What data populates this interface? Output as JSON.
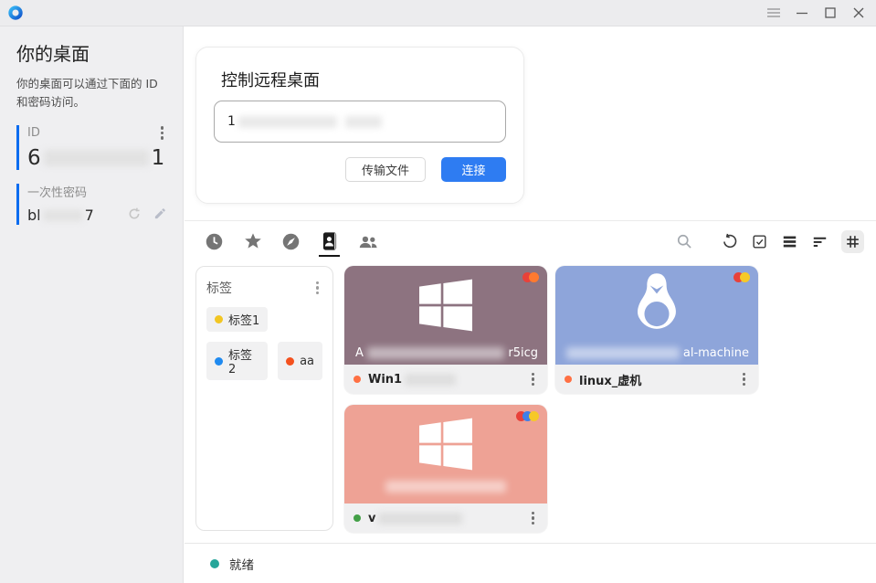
{
  "titlebar": {
    "icons": [
      "menu",
      "minimize",
      "maximize",
      "close"
    ]
  },
  "sidebar": {
    "title": "你的桌面",
    "description": "你的桌面可以通过下面的 ID 和密码访问。",
    "id_label": "ID",
    "id_value_prefix": "6",
    "id_value_suffix": "1",
    "password_label": "一次性密码",
    "password_prefix": "bl",
    "password_suffix": "7",
    "accent_bar_color": "#0a6cf0"
  },
  "connect": {
    "title": "控制远程桌面",
    "id_input_prefix": "1",
    "transfer_file_button": "传输文件",
    "connect_button": "连接",
    "accent_color": "#2e7cf2"
  },
  "toolbar": {
    "tabs": [
      "recent-sessions",
      "favorites",
      "discovered",
      "address-book",
      "groups"
    ],
    "selected_tab": "address-book",
    "actions": [
      "search",
      "refresh",
      "select",
      "list-view",
      "sort-by",
      "grid-view"
    ],
    "active_view": "grid-view"
  },
  "address_book": {
    "tags_title": "标签",
    "tags": [
      {
        "label": "标签1",
        "color": "#f2c623"
      },
      {
        "label": "标签2",
        "color": "#1f8af0"
      },
      {
        "label": "aa",
        "color": "#f4511e"
      }
    ],
    "peers": [
      {
        "name_prefix": "Win1",
        "os": "windows",
        "bg": "#8d7380",
        "status_color": "#ff7043",
        "overlay_prefix": "A",
        "overlay_suffix": "r5icg",
        "dots": [
          "#e8413a",
          "#ff7a2f"
        ]
      },
      {
        "name": "linux_虚机",
        "os": "linux",
        "bg": "#8ea5da",
        "status_color": "#ff7043",
        "overlay_suffix": "al-machine",
        "dots": [
          "#e8413a",
          "#f6c927"
        ]
      },
      {
        "name_prefix": "v",
        "os": "windows",
        "bg": "#eea295",
        "status_color": "#43a047",
        "dots": [
          "#e8413a",
          "#3f7fe8",
          "#f6c927"
        ]
      }
    ]
  },
  "statusbar": {
    "text": "就绪",
    "dot_color": "#26a69a"
  }
}
